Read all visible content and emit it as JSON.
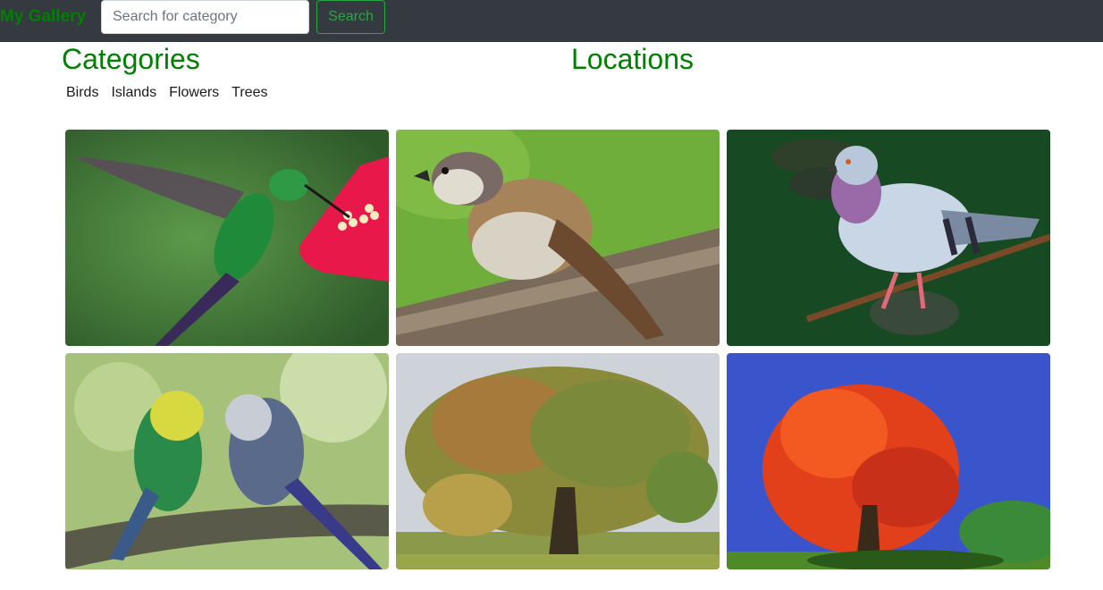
{
  "navbar": {
    "brand": "My Gallery",
    "search_placeholder": "Search for category",
    "search_button": "Search"
  },
  "headings": {
    "categories": "Categories",
    "locations": "Locations"
  },
  "categories": [
    "Birds",
    "Islands",
    "Flowers",
    "Trees"
  ],
  "gallery": [
    {
      "subject": "hummingbird"
    },
    {
      "subject": "sparrow"
    },
    {
      "subject": "pigeon"
    },
    {
      "subject": "budgies"
    },
    {
      "subject": "oak-tree"
    },
    {
      "subject": "red-maple-tree"
    }
  ],
  "colors": {
    "navbar_bg": "#343a40",
    "brand": "#008000",
    "heading": "#008000",
    "search_button": "#28a745"
  }
}
